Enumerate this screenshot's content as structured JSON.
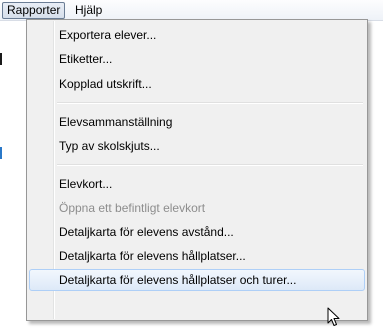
{
  "menubar": {
    "items": [
      {
        "label": "Rapporter",
        "active": true
      },
      {
        "label": "Hjälp",
        "active": false
      }
    ]
  },
  "dropdown": {
    "groups": [
      {
        "items": [
          {
            "label": "Exportera elever...",
            "enabled": true
          },
          {
            "label": "Etiketter...",
            "enabled": true
          },
          {
            "label": "Kopplad utskrift...",
            "enabled": true
          }
        ]
      },
      {
        "items": [
          {
            "label": "Elevsammanställning",
            "enabled": true
          },
          {
            "label": "Typ av skolskjuts...",
            "enabled": true
          }
        ]
      },
      {
        "items": [
          {
            "label": "Elevkort...",
            "enabled": true
          },
          {
            "label": "Öppna ett befintligt elevkort",
            "enabled": false
          },
          {
            "label": "Detaljkarta för elevens avstånd...",
            "enabled": true
          },
          {
            "label": "Detaljkarta för elevens hållplatser...",
            "enabled": true
          },
          {
            "label": "Detaljkarta för elevens hållplatser och turer...",
            "enabled": true,
            "highlighted": true
          }
        ]
      }
    ]
  },
  "colors": {
    "highlight_border": "#aecff7",
    "menu_background": "#f0f0f0",
    "disabled_text": "#8d8d8d"
  },
  "icons": {
    "cursor": "mouse-pointer-icon"
  }
}
